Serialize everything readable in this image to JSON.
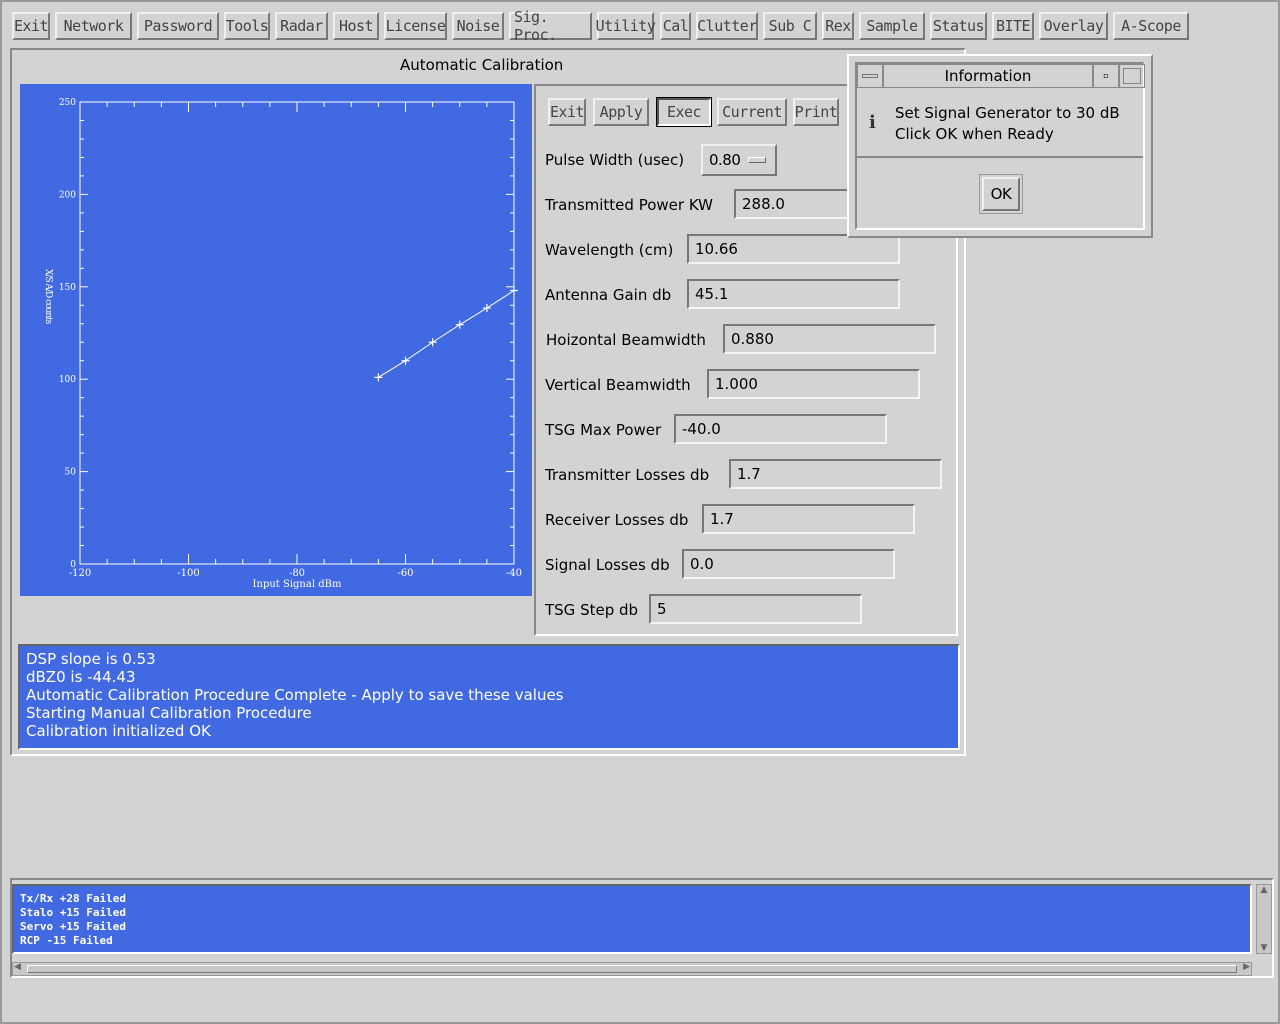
{
  "menubar": [
    "Exit",
    "Network",
    "Password",
    "Tools",
    "Radar",
    "Host",
    "License",
    "Noise",
    "Sig. Proc.",
    "Utility",
    "Cal",
    "Clutter",
    "Sub C",
    "Rex",
    "Sample",
    "Status",
    "BITE",
    "Overlay",
    "A-Scope"
  ],
  "panel_title": "Automatic Calibration",
  "toolbar": [
    "Exit",
    "Apply",
    "Exec",
    "Current",
    "Print"
  ],
  "form": {
    "pulse_width_label": "Pulse Width (usec)",
    "pulse_width_value": "0.80",
    "fields": [
      {
        "label": "Transmitted Power KW",
        "value": "288.0"
      },
      {
        "label": "Wavelength (cm)",
        "value": "10.66"
      },
      {
        "label": "Antenna Gain db",
        "value": "45.1"
      },
      {
        "label": "Hoizontal Beamwidth",
        "value": "0.880"
      },
      {
        "label": "Vertical Beamwidth",
        "value": "1.000"
      },
      {
        "label": "TSG Max Power",
        "value": "-40.0"
      },
      {
        "label": "Transmitter Losses db",
        "value": "1.7"
      },
      {
        "label": "Receiver Losses db",
        "value": "1.7"
      },
      {
        "label": "Signal Losses db",
        "value": "0.0"
      },
      {
        "label": "TSG Step db",
        "value": "5"
      }
    ]
  },
  "messages": [
    "DSP slope is   0.53",
    "dBZ0 is     -44.43",
    "Automatic Calibration Procedure Complete - Apply to save these values",
    "Starting Manual Calibration Procedure",
    "Calibration initialized OK"
  ],
  "status_lines": [
    "Tx/Rx +28 Failed",
    "Stalo +15 Failed",
    "Servo +15 Failed",
    "RCP -15 Failed"
  ],
  "dialog": {
    "title": "Information",
    "line1": "Set Signal Generator to 30 dB",
    "line2": "Click OK when Ready",
    "ok": "OK",
    "icon": "info-icon"
  },
  "colors": {
    "plot_bg": "#4169e1",
    "panel_bg": "#d3d3d3"
  },
  "chart_data": {
    "type": "line",
    "xlabel": "Input Signal dBm",
    "ylabel": "X/S A/D counts",
    "xlim": [
      -120,
      -40
    ],
    "ylim": [
      0,
      250
    ],
    "xticks": [
      -120,
      -100,
      -80,
      -60,
      -40
    ],
    "yticks": [
      0,
      50,
      100,
      150,
      200,
      250
    ],
    "x": [
      -65,
      -60,
      -55,
      -50,
      -45,
      -40
    ],
    "y": [
      101,
      110,
      120,
      129.5,
      138.5,
      148
    ],
    "marker": "plus",
    "grid": false
  }
}
